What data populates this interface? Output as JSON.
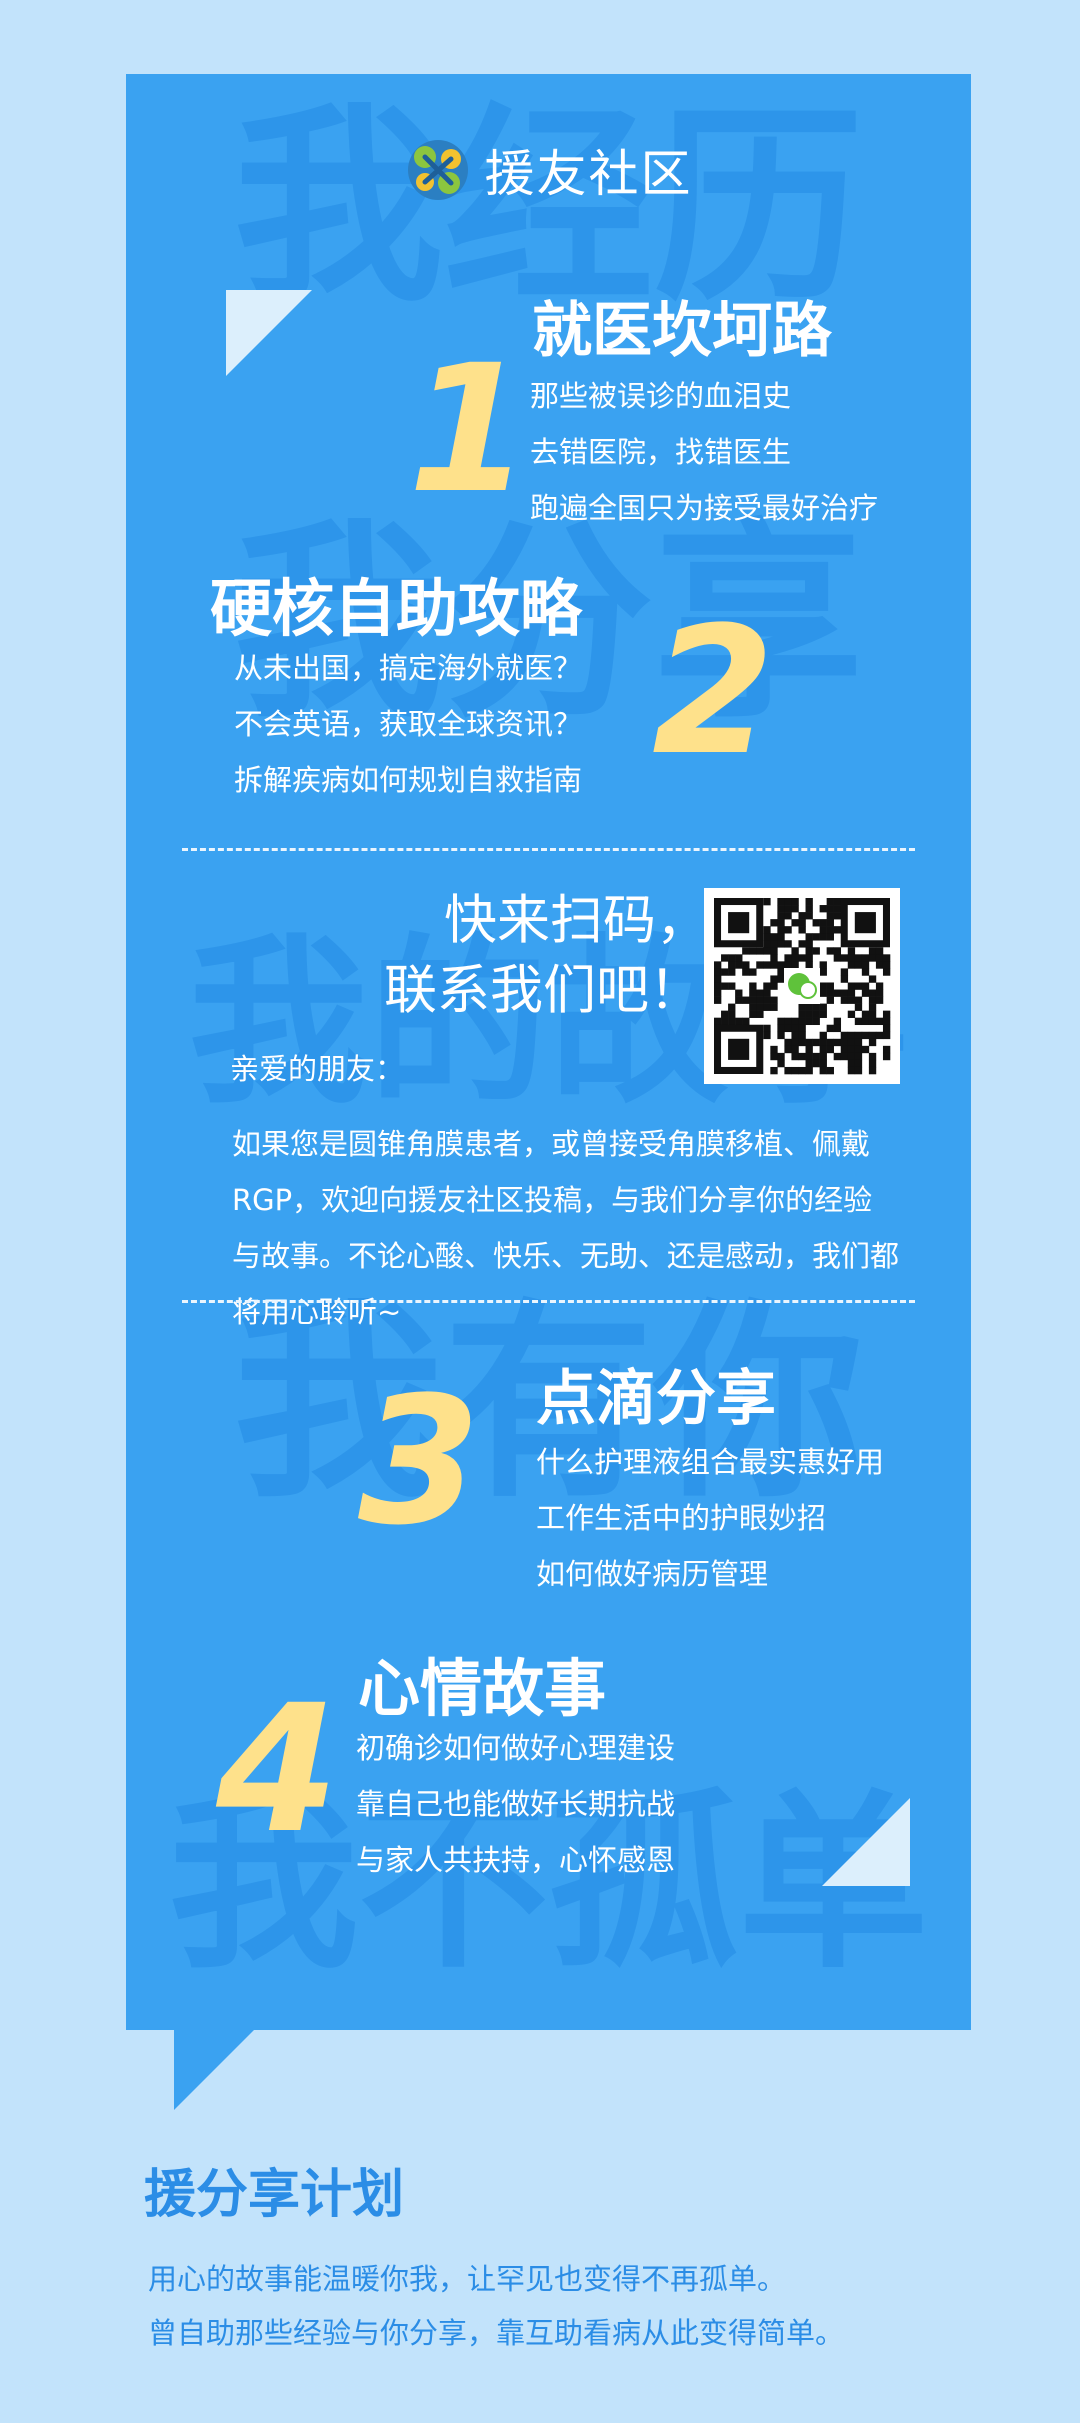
{
  "brand": {
    "name": "援友社区"
  },
  "watermarks": [
    "我经历",
    "我分享",
    "我的故事",
    "我有你",
    "我不孤单"
  ],
  "sections": [
    {
      "number": "1",
      "title": "就医坎坷路",
      "lines": [
        "那些被误诊的血泪史",
        "去错医院，找错医生",
        "跑遍全国只为接受最好治疗"
      ]
    },
    {
      "number": "2",
      "title": "硬核自助攻略",
      "lines": [
        "从未出国，搞定海外就医？",
        "不会英语，获取全球资讯？",
        "拆解疾病如何规划自救指南"
      ]
    },
    {
      "number": "3",
      "title": "点滴分享",
      "lines": [
        "什么护理液组合最实惠好用",
        "工作生活中的护眼妙招",
        "如何做好病历管理"
      ]
    },
    {
      "number": "4",
      "title": "心情故事",
      "lines": [
        "初确诊如何做好心理建设",
        "靠自己也能做好长期抗战",
        "与家人共扶持，心怀感恩"
      ]
    }
  ],
  "cta": {
    "line1": "快来扫码，",
    "line2": "联系我们吧！"
  },
  "letter": {
    "greeting": "亲爱的朋友：",
    "body": "如果您是圆锥角膜患者，或曾接受角膜移植、佩戴RGP，欢迎向援友社区投稿，与我们分享你的经验与故事。不论心酸、快乐、无助、还是感动，我们都将用心聆听~"
  },
  "footer": {
    "title": "援分享计划",
    "line1": "用心的故事能温暖你我，让罕见也变得不再孤单。",
    "line2": "曾自助那些经验与你分享，靠互助看病从此变得简单。"
  },
  "colors": {
    "background": "#c2e3fb",
    "panel": "#3aa2f1",
    "accent_number": "#fee18b",
    "footer_text": "#2b8de6"
  },
  "icons": [
    "logo-icon",
    "qr-code",
    "wechat-icon"
  ]
}
